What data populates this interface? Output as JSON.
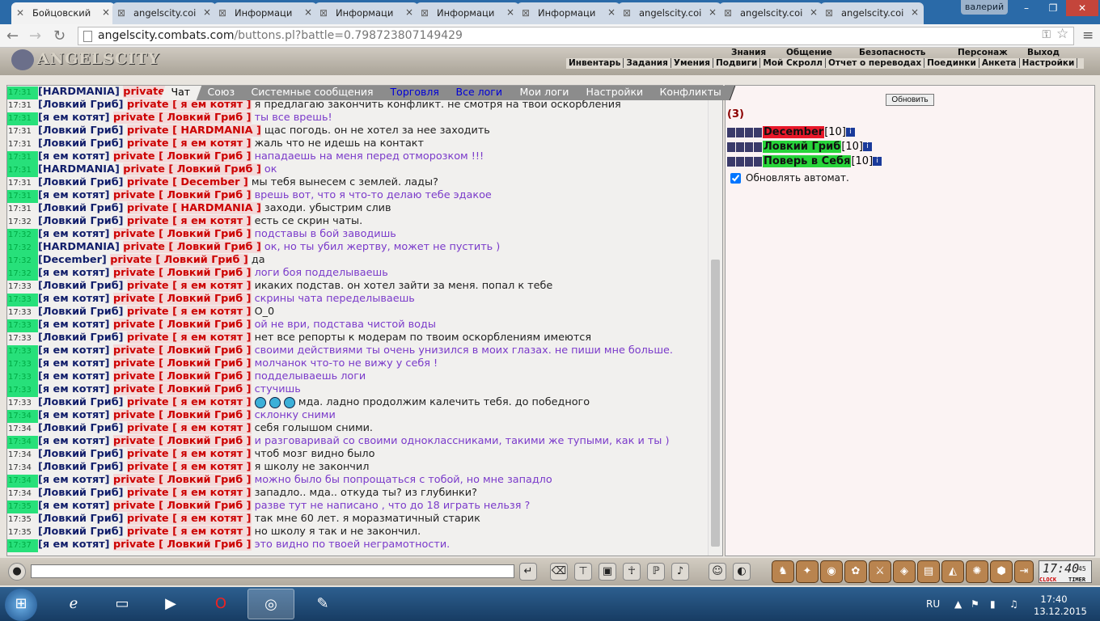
{
  "browser": {
    "tabs": [
      {
        "label": "Бойцовский",
        "active": true
      },
      {
        "label": "angelscity.coi"
      },
      {
        "label": "Информаци"
      },
      {
        "label": "Информаци"
      },
      {
        "label": "Информаци"
      },
      {
        "label": "Информаци"
      },
      {
        "label": "angelscity.coi"
      },
      {
        "label": "angelscity.coi"
      },
      {
        "label": "angelscity.coi"
      }
    ],
    "profile": "валерий",
    "url_host": "angelscity.combats.com",
    "url_path": "/buttons.pl?battle=0.798723807149429"
  },
  "game": {
    "logo": "ANGELSCITY",
    "top_menu": [
      "Знания",
      "Общение",
      "Безопасность",
      "Персонаж",
      "Выход"
    ],
    "sub_menu": [
      "Инвентарь",
      "Задания",
      "Умения",
      "Подвиги",
      "Мой Скролл",
      "Отчет о переводах",
      "Поединки",
      "Анкета",
      "Настройки"
    ]
  },
  "chat": {
    "tabs": [
      {
        "label": "Чат",
        "active": true
      },
      {
        "label": "Союз"
      },
      {
        "label": "Системные сообщения"
      },
      {
        "label": "Торговля",
        "blue": true
      },
      {
        "label": "Все логи",
        "blue": true
      },
      {
        "label": "Мои логи"
      },
      {
        "label": "Настройки"
      },
      {
        "label": "Конфликты"
      }
    ],
    "private_word": "private",
    "messages": [
      {
        "t": "17:31",
        "hl": true,
        "from": "HARDMANIA",
        "to": "Ловкий Гриб",
        "text": "",
        "v": false
      },
      {
        "t": "17:31",
        "hl": false,
        "from": "Ловкий Гриб",
        "to": "я ем котят",
        "text": "я предлагаю закончить конфликт. не смотря на твои оскорбления",
        "v": false
      },
      {
        "t": "17:31",
        "hl": true,
        "from": "я ем котят",
        "to": "Ловкий Гриб",
        "text": "ты все врешь!",
        "v": true
      },
      {
        "t": "17:31",
        "hl": false,
        "from": "Ловкий Гриб",
        "to": "HARDMANIA",
        "text": "щас погодь. он не хотел за нее заходить",
        "v": false
      },
      {
        "t": "17:31",
        "hl": false,
        "from": "Ловкий Гриб",
        "to": "я ем котят",
        "text": "жаль что не идешь на контакт",
        "v": false
      },
      {
        "t": "17:31",
        "hl": true,
        "from": "я ем котят",
        "to": "Ловкий Гриб",
        "text": "нападаешь на меня перед отморозком !!!",
        "v": true
      },
      {
        "t": "17:31",
        "hl": true,
        "from": "HARDMANIA",
        "to": "Ловкий Гриб",
        "text": "ок",
        "v": true
      },
      {
        "t": "17:31",
        "hl": false,
        "from": "Ловкий Гриб",
        "to": "December",
        "text": "мы тебя вынесем с землей. лады?",
        "v": false
      },
      {
        "t": "17:31",
        "hl": true,
        "from": "я ем котят",
        "to": "Ловкий Гриб",
        "text": "врешь вот, что я что-то делаю тебе эдакое",
        "v": true
      },
      {
        "t": "17:31",
        "hl": false,
        "from": "Ловкий Гриб",
        "to": "HARDMANIA",
        "text": "заходи. убыстрим слив",
        "v": false
      },
      {
        "t": "17:32",
        "hl": false,
        "from": "Ловкий Гриб",
        "to": "я ем котят",
        "text": "есть се скрин чаты.",
        "v": false
      },
      {
        "t": "17:32",
        "hl": true,
        "from": "я ем котят",
        "to": "Ловкий Гриб",
        "text": "подставы в бой заводишь",
        "v": true
      },
      {
        "t": "17:32",
        "hl": true,
        "from": "HARDMANIA",
        "to": "Ловкий Гриб",
        "text": "ок, но ты убил жертву, может не пустить )",
        "v": true
      },
      {
        "t": "17:32",
        "hl": true,
        "from": "December",
        "to": "Ловкий Гриб",
        "text": "да",
        "v": false
      },
      {
        "t": "17:32",
        "hl": true,
        "from": "я ем котят",
        "to": "Ловкий Гриб",
        "text": "логи боя подделываешь",
        "v": true
      },
      {
        "t": "17:33",
        "hl": false,
        "from": "Ловкий Гриб",
        "to": "я ем котят",
        "text": "икаких подстав. он хотел зайти за меня. попал к тебе",
        "v": false
      },
      {
        "t": "17:33",
        "hl": true,
        "from": "я ем котят",
        "to": "Ловкий Гриб",
        "text": "скрины чата переделываешь",
        "v": true
      },
      {
        "t": "17:33",
        "hl": false,
        "from": "Ловкий Гриб",
        "to": "я ем котят",
        "text": "О_0",
        "v": false
      },
      {
        "t": "17:33",
        "hl": true,
        "from": "я ем котят",
        "to": "Ловкий Гриб",
        "text": "ой не ври, подстава чистой воды",
        "v": true
      },
      {
        "t": "17:33",
        "hl": false,
        "from": "Ловкий Гриб",
        "to": "я ем котят",
        "text": "нет все репорты к модерам по твоим оскорблениям имеются",
        "v": false
      },
      {
        "t": "17:33",
        "hl": true,
        "from": "я ем котят",
        "to": "Ловкий Гриб",
        "text": "своими действиями ты очень унизился в моих глазах. не пиши мне больше.",
        "v": true
      },
      {
        "t": "17:33",
        "hl": true,
        "from": "я ем котят",
        "to": "Ловкий Гриб",
        "text": "молчанок что-то не вижу у себя !",
        "v": true
      },
      {
        "t": "17:33",
        "hl": true,
        "from": "я ем котят",
        "to": "Ловкий Гриб",
        "text": "подделываешь логи",
        "v": true
      },
      {
        "t": "17:33",
        "hl": true,
        "from": "я ем котят",
        "to": "Ловкий Гриб",
        "text": "стучишь",
        "v": true
      },
      {
        "t": "17:33",
        "hl": false,
        "from": "Ловкий Гриб",
        "to": "я ем котят",
        "text": "мда. ладно продолжим калечить тебя. до победного",
        "v": false,
        "smiles": true
      },
      {
        "t": "17:34",
        "hl": true,
        "from": "я ем котят",
        "to": "Ловкий Гриб",
        "text": "склонку сними",
        "v": true
      },
      {
        "t": "17:34",
        "hl": false,
        "from": "Ловкий Гриб",
        "to": "я ем котят",
        "text": "себя голышом сними.",
        "v": false
      },
      {
        "t": "17:34",
        "hl": true,
        "from": "я ем котят",
        "to": "Ловкий Гриб",
        "text": "и разговаривай со своими одноклассниками, такими же тупыми, как и ты )",
        "v": true
      },
      {
        "t": "17:34",
        "hl": false,
        "from": "Ловкий Гриб",
        "to": "я ем котят",
        "text": "чтоб мозг видно было",
        "v": false
      },
      {
        "t": "17:34",
        "hl": false,
        "from": "Ловкий Гриб",
        "to": "я ем котят",
        "text": "я школу не закончил",
        "v": false
      },
      {
        "t": "17:34",
        "hl": true,
        "from": "я ем котят",
        "to": "Ловкий Гриб",
        "text": "можно было бы попрощаться с тобой, но мне западло",
        "v": true
      },
      {
        "t": "17:34",
        "hl": false,
        "from": "Ловкий Гриб",
        "to": "я ем котят",
        "text": "западло.. мда.. откуда ты? из глубинки?",
        "v": false
      },
      {
        "t": "17:35",
        "hl": true,
        "from": "я ем котят",
        "to": "Ловкий Гриб",
        "text": "разве тут не написано , что до 18 играть нельзя ?",
        "v": true
      },
      {
        "t": "17:35",
        "hl": false,
        "from": "Ловкий Гриб",
        "to": "я ем котят",
        "text": "так мне 60 лет. я моразматичный старик",
        "v": false
      },
      {
        "t": "17:35",
        "hl": false,
        "from": "Ловкий Гриб",
        "to": "я ем котят",
        "text": "но школу я так и не закончил.",
        "v": false
      },
      {
        "t": "17:37",
        "hl": true,
        "from": "я ем котят",
        "to": "Ловкий Гриб",
        "text": "это видно по твоей неграмотности.",
        "v": true
      }
    ]
  },
  "battle": {
    "refresh_label": "Обновить",
    "count": "(3)",
    "players": [
      {
        "name": "December",
        "level": "[10]",
        "bg": "#e8182a"
      },
      {
        "name": "Ловкий Гриб",
        "level": "[10]",
        "bg": "#27d43a"
      },
      {
        "name": "Поверь в Себя",
        "level": "[10]",
        "bg": "#27d43a"
      }
    ],
    "auto_label": "Обновлять автомат.",
    "info_glyph": "i"
  },
  "clock": {
    "time": "17:40",
    "seconds": "45",
    "clock_label": "CLOCK",
    "timer_label": "TIMER"
  },
  "taskbar": {
    "lang": "RU",
    "time": "17:40",
    "date": "13.12.2015"
  }
}
